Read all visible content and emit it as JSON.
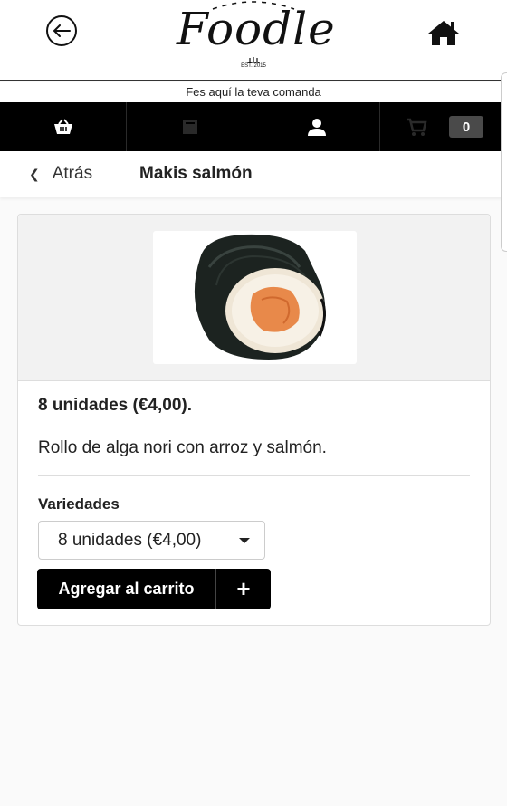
{
  "header": {
    "logo_text": "Foodle",
    "logo_est": "EST. 2015",
    "back_icon": "arrow-left-circle-icon",
    "home_icon": "home-icon"
  },
  "tagline": "Fes aquí la teva comanda",
  "nav": {
    "items": [
      {
        "icon": "basket-icon"
      },
      {
        "icon": "book-icon"
      },
      {
        "icon": "user-icon"
      },
      {
        "icon": "cart-icon"
      }
    ],
    "cart_count": "0"
  },
  "breadcrumb": {
    "back_label": "Atrás",
    "title": "Makis salmón"
  },
  "product": {
    "image_alt": "Maki roll with salmon",
    "title": "8 unidades (€4,00).",
    "description": "Rollo de alga nori con arroz y salmón.",
    "varieties_label": "Variedades",
    "selected_variety": "8 unidades (€4,00)",
    "add_to_cart_label": "Agregar al carrito",
    "add_plus": "+"
  },
  "colors": {
    "nav_bg": "#000000",
    "accent": "#000000",
    "salmon": "#e8894a"
  }
}
